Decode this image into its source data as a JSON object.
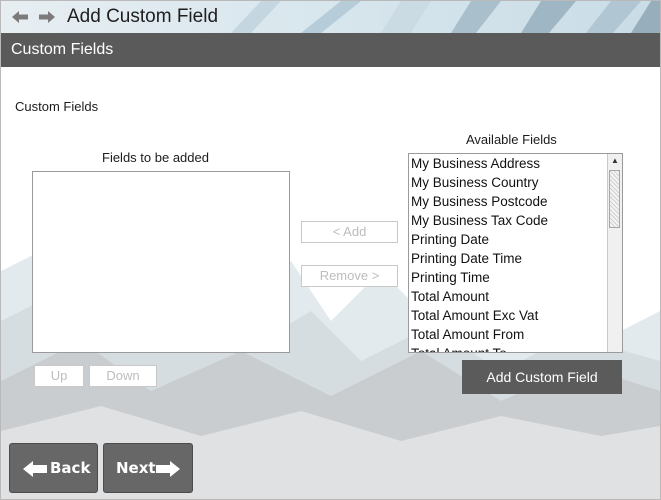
{
  "window": {
    "title": "Add Custom Field"
  },
  "section": {
    "title": "Custom Fields"
  },
  "main": {
    "heading": "Custom Fields",
    "fields_to_add": {
      "label": "Fields to be added",
      "items": []
    },
    "available_fields": {
      "label": "Available Fields",
      "items": [
        "My Business Address",
        "My Business Country",
        "My Business Postcode",
        "My Business Tax Code",
        "Printing Date",
        "Printing Date Time",
        "Printing Time",
        "Total Amount",
        "Total Amount Exc Vat",
        "Total Amount From",
        "Total Amount To"
      ]
    },
    "buttons": {
      "add": "< Add",
      "remove": "Remove >",
      "up": "Up",
      "down": "Down",
      "add_custom_field": "Add Custom Field"
    }
  },
  "footer": {
    "back": "Back",
    "next": "Next"
  },
  "colors": {
    "header": "#5a5a5a",
    "dark_button": "#5b5b5b",
    "footer_button": "#676767"
  },
  "icons": [
    "back-arrow-icon",
    "forward-arrow-icon",
    "scroll-up-icon",
    "arrow-left-icon",
    "arrow-right-icon"
  ]
}
